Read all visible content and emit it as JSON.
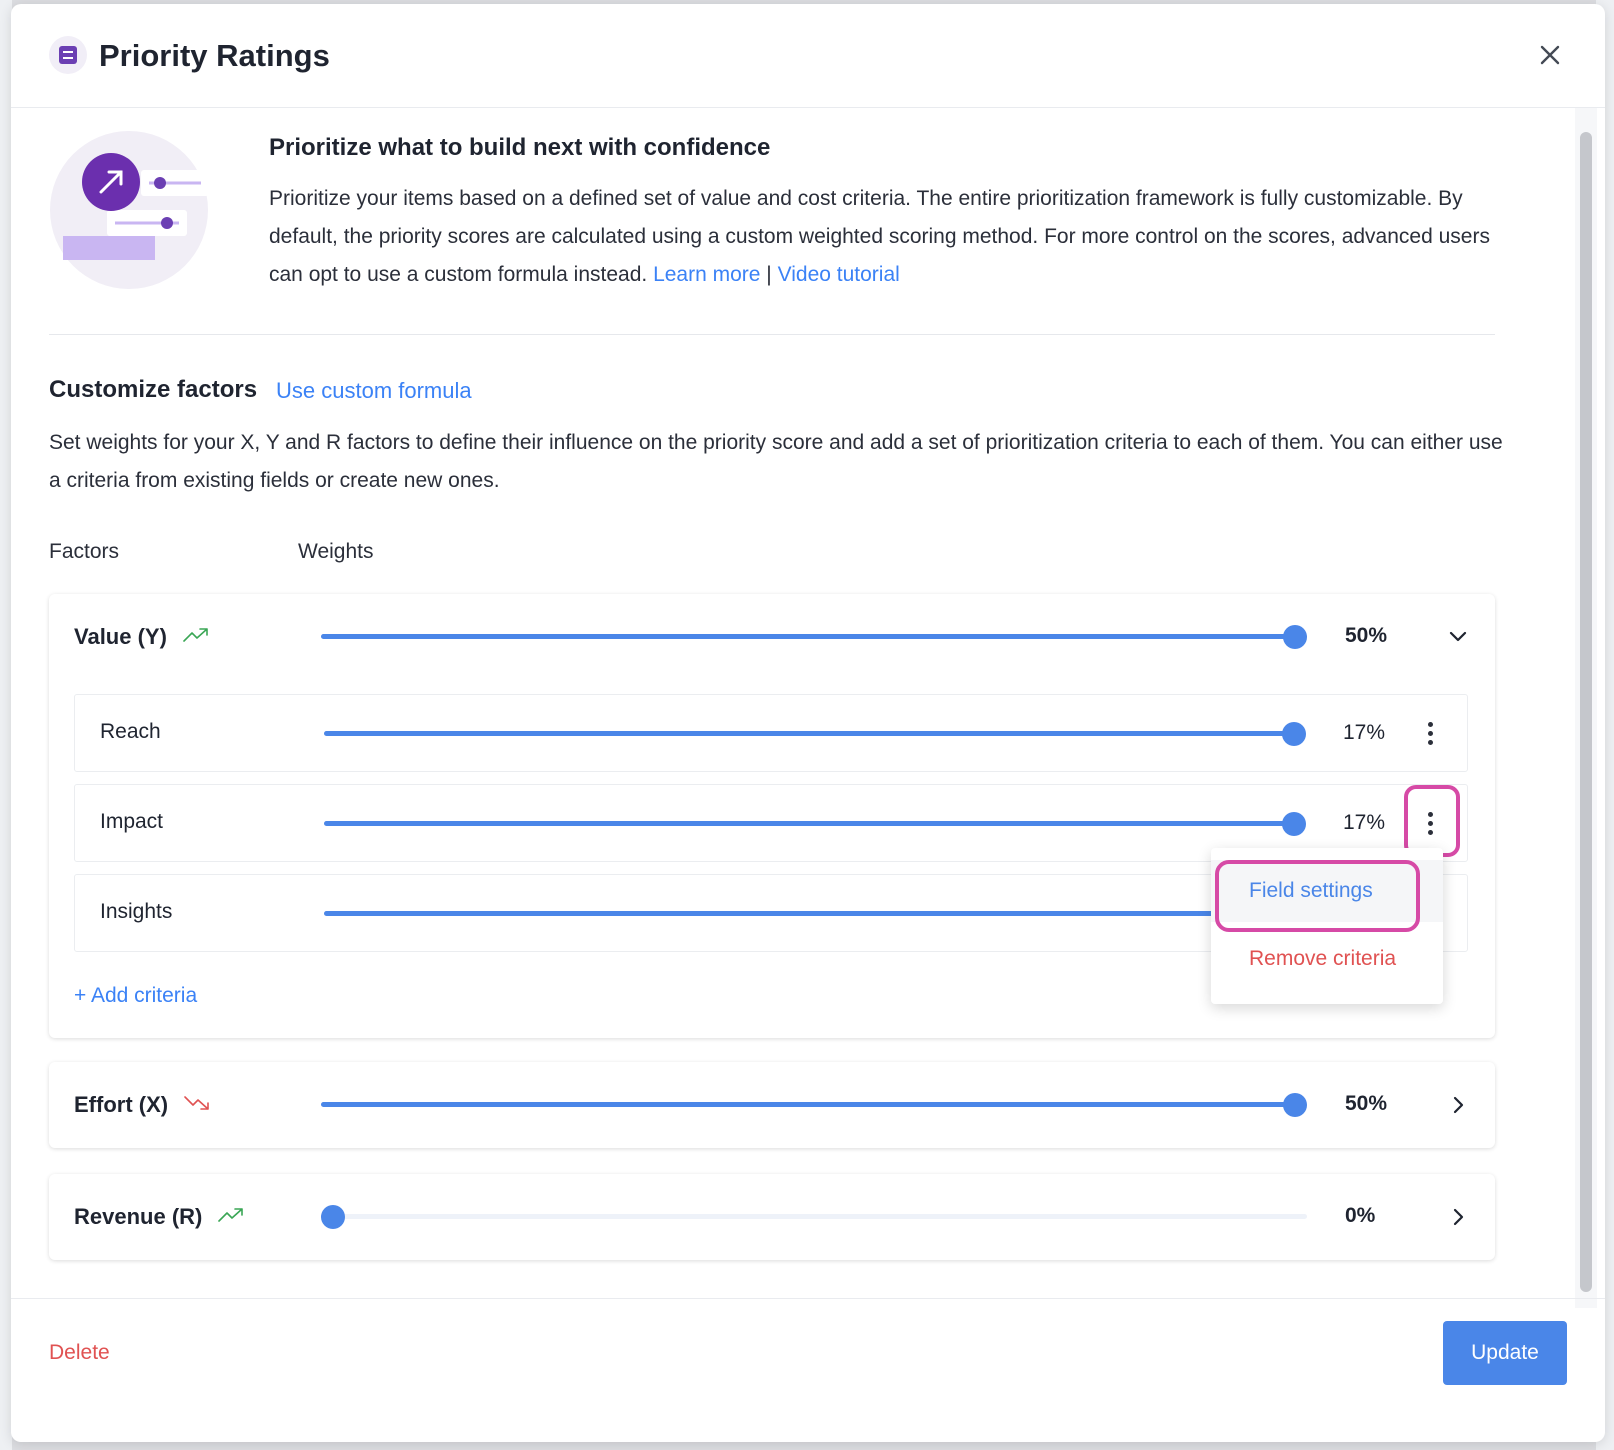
{
  "modal": {
    "title": "Priority Ratings",
    "close_label": "close"
  },
  "intro": {
    "title": "Prioritize what to build next with confidence",
    "text": "Prioritize your items based on a defined set of value and cost criteria. The entire prioritization framework is fully customizable. By default, the priority scores are calculated using a custom weighted scoring method. For more control on the scores, advanced users can opt to use a custom formula instead.",
    "learn_more": "Learn more",
    "separator": "|",
    "video_tutorial": "Video tutorial"
  },
  "customize": {
    "title": "Customize factors",
    "custom_formula_link": "Use custom formula",
    "description": "Set weights for your X, Y and R factors to define their influence on the priority score and add a set of prioritization criteria to each of them. You can either use a criteria from existing fields or create new ones.",
    "col_factors": "Factors",
    "col_weights": "Weights"
  },
  "factors": [
    {
      "name": "Value (Y)",
      "weight_label": "50%",
      "weight": 1.0,
      "trend": "trending-up-icon",
      "trend_color": "#3aa655",
      "expanded": true,
      "criteria": [
        {
          "name": "Reach",
          "weight_label": "17%",
          "weight": 1.0
        },
        {
          "name": "Impact",
          "weight_label": "17%",
          "weight": 1.0
        },
        {
          "name": "Insights",
          "weight_label": "",
          "weight": 1.0
        }
      ],
      "add_label": "+ Add criteria"
    },
    {
      "name": "Effort (X)",
      "weight_label": "50%",
      "weight": 1.0,
      "trend": "trending-down-icon",
      "trend_color": "#e05252",
      "expanded": false
    },
    {
      "name": "Revenue (R)",
      "weight_label": "0%",
      "weight": 0.0,
      "trend": "trending-up-icon",
      "trend_color": "#3aa655",
      "expanded": false
    }
  ],
  "context_menu": {
    "items": [
      "Field settings",
      "Remove criteria"
    ]
  },
  "footer": {
    "delete_label": "Delete",
    "update_label": "Update"
  },
  "colors": {
    "accent": "#4a86e8",
    "danger": "#e05252",
    "highlight": "#d64aa6",
    "brand": "#6b3fb3"
  }
}
